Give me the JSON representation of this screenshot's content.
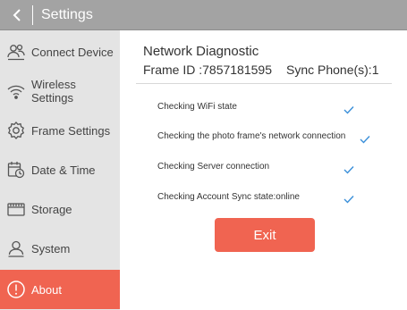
{
  "header": {
    "title": "Settings"
  },
  "sidebar": {
    "items": [
      {
        "label": "Connect Device",
        "icon": "people-icon"
      },
      {
        "label": "Wireless Settings",
        "icon": "wifi-icon"
      },
      {
        "label": "Frame Settings",
        "icon": "frame-settings-icon"
      },
      {
        "label": "Date & Time",
        "icon": "calendar-clock-icon"
      },
      {
        "label": "Storage",
        "icon": "storage-icon"
      },
      {
        "label": "System",
        "icon": "user-icon"
      },
      {
        "label": "About",
        "icon": "info-icon",
        "active": true
      }
    ]
  },
  "main": {
    "heading": "Network Diagnostic",
    "frame_id": "Frame ID :7857181595",
    "sync_phones": "Sync Phone(s):1",
    "checks": [
      {
        "label": "Checking WiFi state",
        "status": "ok"
      },
      {
        "label": "Checking the photo frame's network connection",
        "status": "ok"
      },
      {
        "label": "Checking Server connection",
        "status": "ok"
      },
      {
        "label": "Checking Account Sync state:online",
        "status": "ok"
      }
    ],
    "exit_label": "Exit"
  },
  "colors": {
    "topbar": "#a3a3a3",
    "sidebar": "#e4e4e4",
    "accent": "#f06451",
    "check": "#3a8fd9"
  }
}
